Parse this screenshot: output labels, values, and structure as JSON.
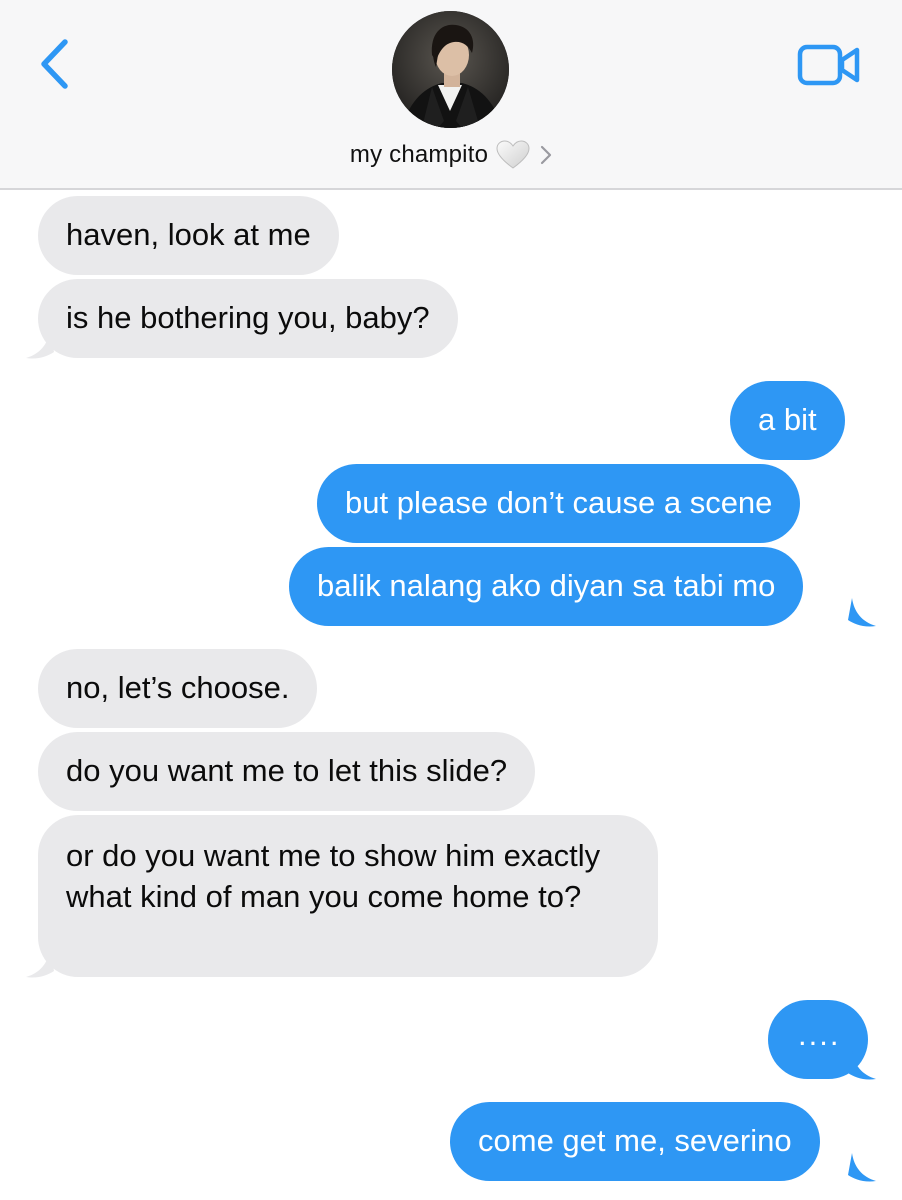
{
  "header": {
    "contact_name": "my champito",
    "icons": {
      "back": "chevron-left-icon",
      "video": "video-camera-icon",
      "heart": "white-heart-icon",
      "disclosure": "chevron-right-icon"
    },
    "accent_color": "#2e97f4"
  },
  "messages": [
    {
      "direction": "incoming",
      "text": "haven, look at me"
    },
    {
      "direction": "incoming",
      "text": "is he bothering you, baby?"
    },
    {
      "direction": "outgoing",
      "text": "a bit"
    },
    {
      "direction": "outgoing",
      "text": "but please don’t cause a scene"
    },
    {
      "direction": "outgoing",
      "text": "balik nalang ako diyan sa tabi mo"
    },
    {
      "direction": "incoming",
      "text": "no, let’s choose."
    },
    {
      "direction": "incoming",
      "text": "do you want me to let this slide?"
    },
    {
      "direction": "incoming",
      "text": "or do you want me to show him exactly what kind of man you come home to?"
    },
    {
      "direction": "outgoing",
      "text": "...."
    },
    {
      "direction": "outgoing",
      "text": "come get me, severino"
    }
  ],
  "colors": {
    "incoming_bubble": "#e9e9eb",
    "outgoing_bubble": "#2e97f4",
    "header_background": "#f7f7f8"
  }
}
